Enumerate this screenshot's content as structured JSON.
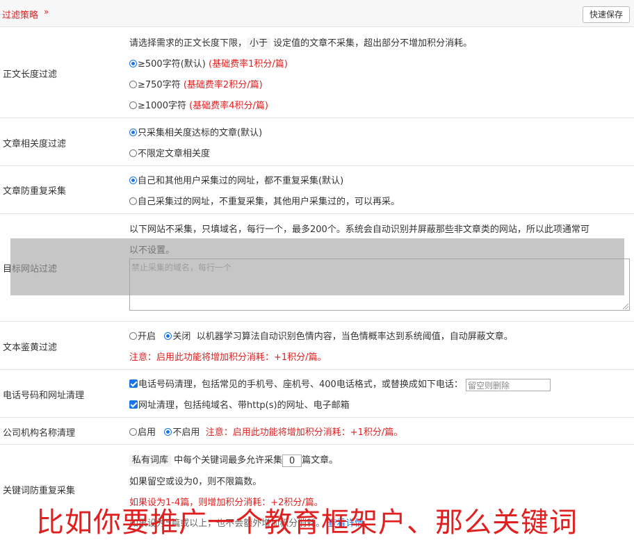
{
  "header": {
    "title": "过滤策略",
    "chevron": "»",
    "save_label": "快速保存"
  },
  "length": {
    "label": "正文长度过滤",
    "desc_before": "请选择需求的正文长度下限，",
    "desc_chip": "小于",
    "desc_after": " 设定值的文章不采集，超出部分不增加积分消耗。",
    "opt1": "≥500字符(默认)",
    "opt1_note": "(基础费率1积分/篇)",
    "opt2": "≥750字符",
    "opt2_note": "(基础费率2积分/篇)",
    "opt3": "≥1000字符",
    "opt3_note": "(基础费率4积分/篇)"
  },
  "relevance": {
    "label": "文章相关度过滤",
    "opt1": "只采集相关度达标的文章(默认)",
    "opt2": "不限定文章相关度"
  },
  "dedup": {
    "label": "文章防重复采集",
    "opt1": "自己和其他用户采集过的网址，都不重复采集(默认)",
    "opt2": "自己采集过的网址，不重复采集，其他用户采集过的，可以再采。"
  },
  "site": {
    "label": "目标网站过滤",
    "desc1": "以下网站不采集，只填域名，每行一个，最多200个。系统会自动识别并屏蔽那些非文章类的网站，所以此项通常可",
    "desc2": "以不设置。",
    "placeholder": "禁止采集的域名，每行一个"
  },
  "porn": {
    "label": "文本鉴黄过滤",
    "on": "开启",
    "off": "关闭",
    "desc": "以机器学习算法自动识别色情内容，当色情概率达到系统阈值，自动屏蔽文章。",
    "note": "注意：启用此功能将增加积分消耗：+1积分/篇。"
  },
  "phone": {
    "label": "电话号码和网址清理",
    "opt1": "电话号码清理，包括常见的手机号、座机号、400电话格式，或替换成如下电话：",
    "input_placeholder": "留空则删除",
    "opt2": "网址清理，包括纯域名、带http(s)的网址、电子邮箱"
  },
  "org": {
    "label": "公司机构名称清理",
    "on": "启用",
    "off": "不启用",
    "note": "注意：启用此功能将增加积分消耗：+1积分/篇。"
  },
  "keyword": {
    "label": "关键词防重复采集",
    "chip": "私有词库",
    "text_a": " 中每个关键词最多允许采集",
    "value": "0",
    "text_b": "篇文章。",
    "line2": "如果留空或设为0，则不限篇数。",
    "line3": "如果设为1-4篇，则增加积分消耗：+2积分/篇。",
    "line4": "如果设为5篇或以上，也不会额外增加积分消耗。",
    "link": "查看详情"
  },
  "subtitle": "比如你要推广一个教育框架户、那么关键词"
}
